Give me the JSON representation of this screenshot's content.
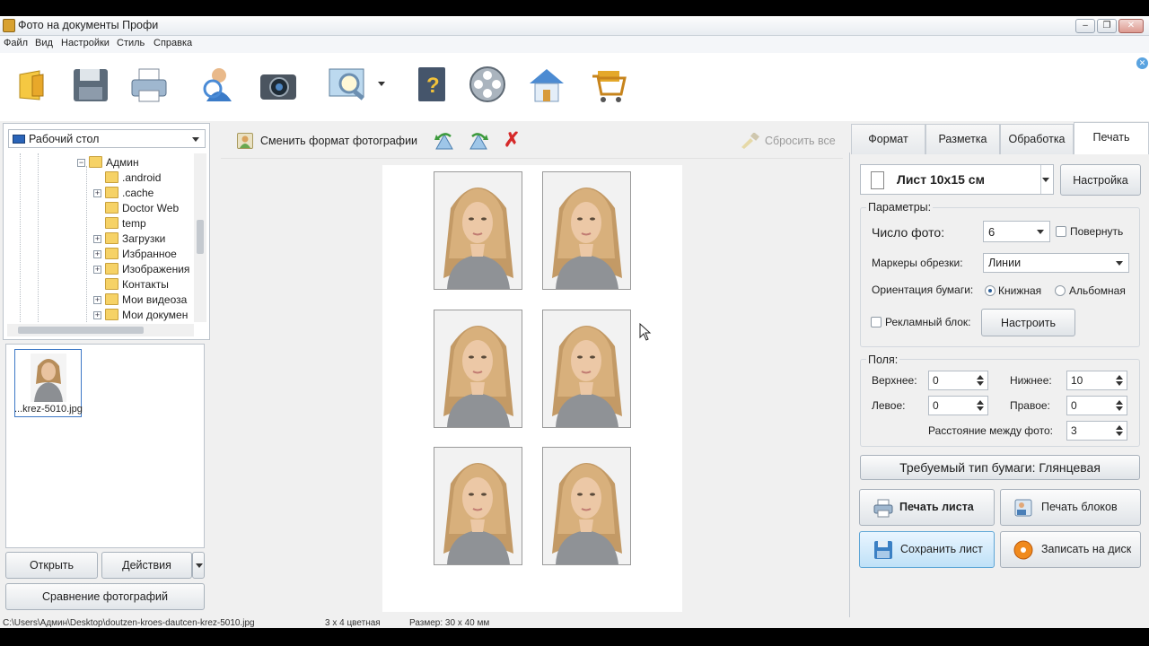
{
  "window": {
    "title": "Фото на документы Профи"
  },
  "menu": [
    "Файл",
    "Вид",
    "Настройки",
    "Стиль",
    "Справка"
  ],
  "toolbar_icons": [
    "open-folder-icon",
    "save-disk-icon",
    "printer-icon",
    "person-search-icon",
    "camera-icon",
    "photo-zoom-icon",
    "book-help-icon",
    "film-reel-icon",
    "home-icon",
    "shopping-cart-icon"
  ],
  "left": {
    "location_combo": "Рабочий стол",
    "tree": [
      {
        "label": "Админ",
        "expander": "⊟",
        "indent": 0
      },
      {
        "label": ".android",
        "expander": "",
        "indent": 1
      },
      {
        "label": ".cache",
        "expander": "⊞",
        "indent": 1
      },
      {
        "label": "Doctor Web",
        "expander": "",
        "indent": 1
      },
      {
        "label": "temp",
        "expander": "",
        "indent": 1
      },
      {
        "label": "Загрузки",
        "expander": "⊞",
        "indent": 1
      },
      {
        "label": "Избранное",
        "expander": "⊞",
        "indent": 1
      },
      {
        "label": "Изображения",
        "expander": "⊞",
        "indent": 1
      },
      {
        "label": "Контакты",
        "expander": "",
        "indent": 1
      },
      {
        "label": "Мои видеоза",
        "expander": "⊞",
        "indent": 1
      },
      {
        "label": "Мои докумен",
        "expander": "⊞",
        "indent": 1
      }
    ],
    "thumbnail_caption": "...krez-5010.jpg",
    "open_button": "Открыть",
    "actions_button": "Действия",
    "compare_button": "Сравнение фотографий"
  },
  "center": {
    "change_format": "Сменить формат фотографии",
    "reset_all": "Сбросить все",
    "photo_count": 6
  },
  "right": {
    "tabs": [
      "Формат",
      "Разметка",
      "Обработка",
      "Печать"
    ],
    "active_tab": "Печать",
    "sheet_combo": "Лист 10x15 см",
    "setup_button": "Настройка",
    "params_label": "Параметры:",
    "photo_count_label": "Число фото:",
    "photo_count_value": "6",
    "rotate_label": "Повернуть",
    "crop_marks_label": "Маркеры обрезки:",
    "crop_marks_value": "Линии",
    "orientation_label": "Ориентация бумаги:",
    "portrait_label": "Книжная",
    "landscape_label": "Альбомная",
    "ad_block_label": "Рекламный блок:",
    "configure_button": "Настроить",
    "margins_label": "Поля:",
    "top_label": "Верхнее:",
    "top_value": "0",
    "bottom_label": "Нижнее:",
    "bottom_value": "10",
    "left_label": "Левое:",
    "left_value": "0",
    "right_label": "Правое:",
    "right_value": "0",
    "spacing_label": "Расстояние между фото:",
    "spacing_value": "3",
    "paper_type": "Требуемый тип бумаги: Глянцевая",
    "print_sheet": "Печать листа",
    "print_blocks": "Печать блоков",
    "save_sheet": "Сохранить лист",
    "burn_disc": "Записать на диск"
  },
  "status": {
    "path": "C:\\Users\\Админ\\Desktop\\doutzen-kroes-dautcen-krez-5010.jpg",
    "format": "3 x 4 цветная",
    "size": "Размер: 30 x 40 мм"
  },
  "colors": {
    "accent_blue": "#bfe1f7",
    "title_bg": "#e8ecf1",
    "panel_bg": "#f0f0f0"
  }
}
